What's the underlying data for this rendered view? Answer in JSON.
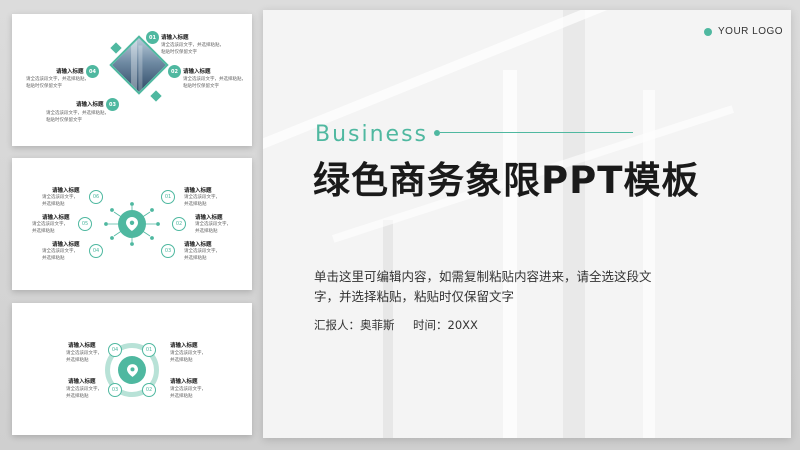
{
  "colors": {
    "accent": "#4fb8a0",
    "text_dark": "#1a1a1a",
    "text_body": "#333333"
  },
  "main_slide": {
    "logo": "YOUR LOGO",
    "subtitle_en": "Business",
    "title": "绿色商务象限PPT模板",
    "body_line1": "单击这里可编辑内容，如需复制粘贴内容进来，请全选这段文",
    "body_line2": "字，并选择粘贴，粘贴时仅保留文字",
    "reporter": "汇报人：奥菲斯",
    "time": "时间：20XX"
  },
  "thumb1": {
    "items": [
      {
        "num": "01",
        "title": "请输入标题",
        "line1": "请全选该段文字，并选择粘贴，",
        "line2": "粘贴时仅保留文字"
      },
      {
        "num": "02",
        "title": "请输入标题",
        "line1": "请全选该段文字，并选择粘贴，",
        "line2": "粘贴时仅保留文字"
      },
      {
        "num": "03",
        "title": "请输入标题",
        "line1": "请全选该段文字，并选择粘贴，",
        "line2": "粘贴时仅保留文字"
      },
      {
        "num": "04",
        "title": "请输入标题",
        "line1": "请全选该段文字，并选择粘贴，",
        "line2": "粘贴时仅保留文字"
      }
    ]
  },
  "thumb2": {
    "items": [
      {
        "num": "01",
        "title": "请输入标题",
        "line1": "请全选该段文字，",
        "line2": "并选择粘贴"
      },
      {
        "num": "02",
        "title": "请输入标题",
        "line1": "请全选该段文字，",
        "line2": "并选择粘贴"
      },
      {
        "num": "03",
        "title": "请输入标题",
        "line1": "请全选该段文字，",
        "line2": "并选择粘贴"
      },
      {
        "num": "04",
        "title": "请输入标题",
        "line1": "请全选该段文字，",
        "line2": "并选择粘贴"
      },
      {
        "num": "05",
        "title": "请输入标题",
        "line1": "请全选该段文字，",
        "line2": "并选择粘贴"
      },
      {
        "num": "06",
        "title": "请输入标题",
        "line1": "请全选该段文字，",
        "line2": "并选择粘贴"
      }
    ]
  },
  "thumb3": {
    "items": [
      {
        "num": "01",
        "title": "请输入标题",
        "line1": "请全选该段文字，",
        "line2": "并选择粘贴"
      },
      {
        "num": "02",
        "title": "请输入标题",
        "line1": "请全选该段文字，",
        "line2": "并选择粘贴"
      },
      {
        "num": "03",
        "title": "请输入标题",
        "line1": "请全选该段文字，",
        "line2": "并选择粘贴"
      },
      {
        "num": "04",
        "title": "请输入标题",
        "line1": "请全选该段文字，",
        "line2": "并选择粘贴"
      }
    ]
  }
}
